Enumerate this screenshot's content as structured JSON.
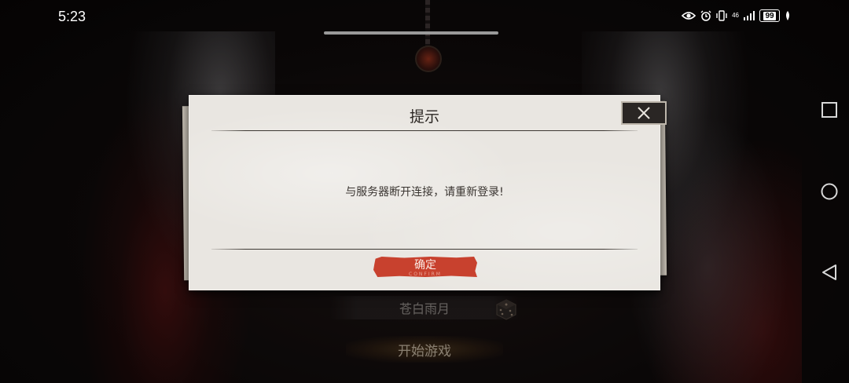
{
  "status_bar": {
    "time": "5:23",
    "network_label": "46",
    "battery_level": "99",
    "icons": [
      "eye-icon",
      "alarm-icon",
      "vibrate-icon",
      "signal-icon",
      "battery-icon",
      "leaf-icon"
    ]
  },
  "game": {
    "server_name": "苍白雨月",
    "start_label": "开始游戏"
  },
  "dialog": {
    "title": "提示",
    "message": "与服务器断开连接，请重新登录!",
    "confirm_label": "确定",
    "confirm_sublabel": "CONFIRM",
    "close_icon": "close-icon"
  },
  "colors": {
    "dialog_bg": "#e9e6e1",
    "confirm_button": "#c8412e",
    "close_button_bg": "#2a2624"
  }
}
